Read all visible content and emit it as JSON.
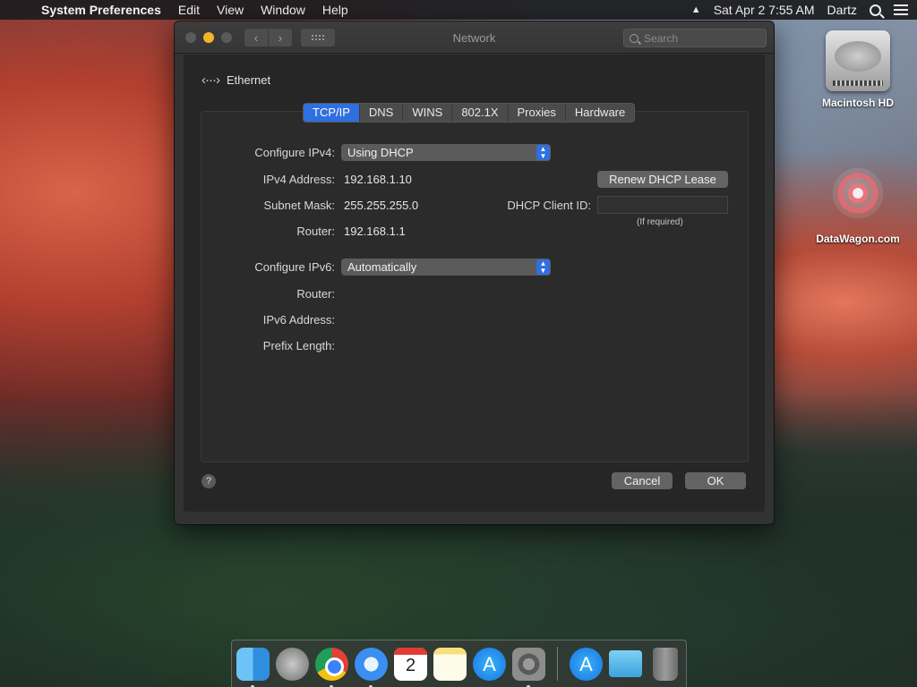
{
  "menubar": {
    "app_name": "System Preferences",
    "items": [
      "Edit",
      "View",
      "Window",
      "Help"
    ],
    "datetime": "Sat Apr 2  7:55 AM",
    "user": "Dartz"
  },
  "window": {
    "title": "Network",
    "search_placeholder": "Search",
    "interface_name": "Ethernet",
    "tabs": [
      {
        "label": "TCP/IP",
        "active": true
      },
      {
        "label": "DNS",
        "active": false
      },
      {
        "label": "WINS",
        "active": false
      },
      {
        "label": "802.1X",
        "active": false
      },
      {
        "label": "Proxies",
        "active": false
      },
      {
        "label": "Hardware",
        "active": false
      }
    ],
    "ipv4": {
      "configure_label": "Configure IPv4:",
      "configure_value": "Using DHCP",
      "address_label": "IPv4 Address:",
      "address_value": "192.168.1.10",
      "subnet_label": "Subnet Mask:",
      "subnet_value": "255.255.255.0",
      "router_label": "Router:",
      "router_value": "192.168.1.1",
      "renew_button": "Renew DHCP Lease",
      "client_id_label": "DHCP Client ID:",
      "client_id_value": "",
      "client_id_hint": "(If required)"
    },
    "ipv6": {
      "configure_label": "Configure IPv6:",
      "configure_value": "Automatically",
      "router_label": "Router:",
      "address_label": "IPv6 Address:",
      "prefix_label": "Prefix Length:"
    },
    "help_label": "?",
    "cancel_button": "Cancel",
    "ok_button": "OK"
  },
  "desktop": {
    "icons": [
      "Macintosh HD",
      "DataWagon.com"
    ]
  },
  "dock": {
    "calendar_day": "2",
    "items": [
      "finder-icon",
      "launchpad-icon",
      "chrome-icon",
      "safari-icon",
      "calendar-icon",
      "notes-icon",
      "app-store-icon",
      "system-preferences-icon",
      "app-store-icon",
      "downloads-folder-icon",
      "trash-icon"
    ]
  }
}
